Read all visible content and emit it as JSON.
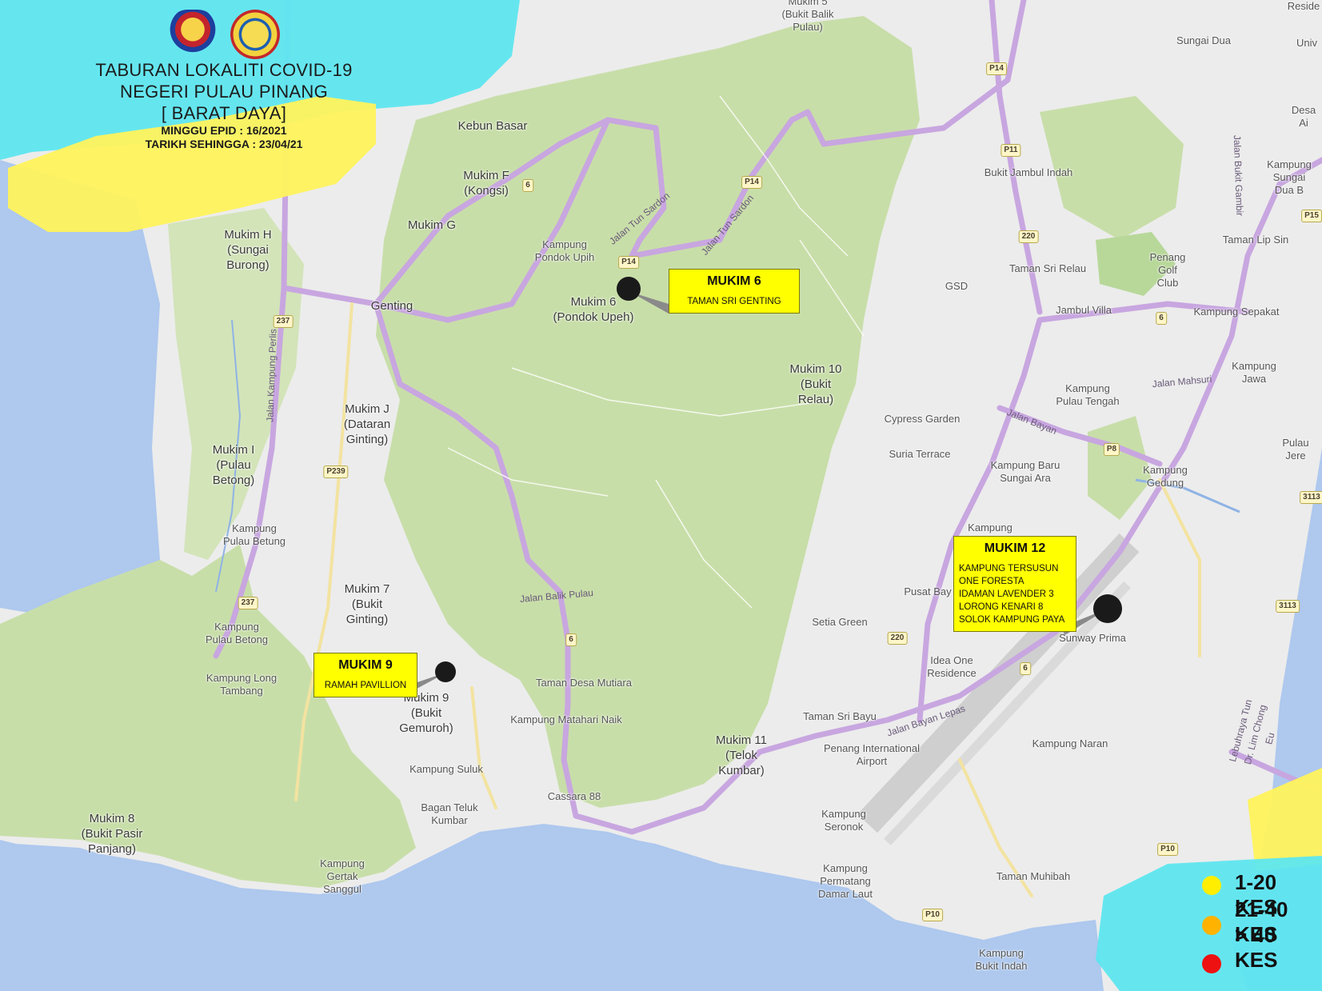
{
  "header": {
    "title_lines": [
      "TABURAN LOKALITI COVID-19",
      "NEGERI PULAU PINANG",
      "[ BARAT DAYA]"
    ],
    "week": "MINGGU EPID : 16/2021",
    "date": "TARIKH SEHINGGA : 23/04/21"
  },
  "place_labels": [
    "Mukim 5\n(Bukit Balik\nPulau)",
    "Sungai Dua",
    "Kebun Basar",
    "Mukim F\n(Kongsi)",
    "Mukim G",
    "Mukim H\n(Sungai\nBurong)",
    "Kampung\nPondok Upih",
    "Genting",
    "Mukim 6\n(Pondok Upeh)",
    "Mukim 10\n(Bukit\nRelau)",
    "Mukim J\n(Dataran\nGinting)",
    "Mukim I\n(Pulau\nBetong)",
    "Kampung\nPulau Betung",
    "Mukim 7\n(Bukit\nGinting)",
    "Kampung\nPulau Betong",
    "Kampung Long\nTambang",
    "Mukim 9\n(Bukit\nGemuroh)",
    "Taman Desa Mutiara",
    "Kampung Matahari Naik",
    "Kampung Suluk",
    "Cassara 88",
    "Bagan Teluk\nKumbar",
    "Mukim 8\n(Bukit Pasir\nPanjang)",
    "Kampung\nGertak\nSanggul",
    "Mukim 11\n(Telok\nKumbar)",
    "Taman Sri Bayu",
    "Penang International\nAirport",
    "Kampung\nSeronok",
    "Kampung\nPermatang\nDamar Laut",
    "Kampung\nBukit Indah",
    "Taman Muhibah",
    "Kampung Naran",
    "Idea One\nResidence",
    "Setia Green",
    "Pusat Bay",
    "Sunway Prima",
    "Kampung",
    "Kampung Baru\nSungai Ara",
    "Suria Terrace",
    "Cypress Garden",
    "Kampung\nPulau Tengah",
    "Kampung\nGedung",
    "Pulau Jere",
    "Kampung Jawa",
    "Kampung Sepakat",
    "Jambul Villa",
    "GSD",
    "Taman Sri Relau",
    "Taman Lip Sin",
    "Penang\nGolf\nClub",
    "Bukit Jambul Indah",
    "Kampung\nSungai Dua B",
    "Desa Ai",
    "Reside",
    "Univ"
  ],
  "road_labels": [
    "Jalan Tun Sardon",
    "Jalan Tun Sardon",
    "Jalan Balik Pulau",
    "Jalan Bayan",
    "Jalan Bayan Lepas",
    "Jalan Kampung Perlis",
    "Jalan Mahsuri",
    "Lebuhraya Tun Dr. Lim Chong Eu",
    "Jalan Bukit Gambir"
  ],
  "route_shields": [
    "P14",
    "P14",
    "P14",
    "P11",
    "220",
    "220",
    "6",
    "6",
    "6",
    "6",
    "237",
    "237",
    "P239",
    "P8",
    "P10",
    "P10",
    "P15",
    "3113",
    "3113"
  ],
  "callouts": [
    {
      "title": "MUKIM 6",
      "lines": [
        "TAMAN SRI GENTING"
      ]
    },
    {
      "title": "MUKIM 9",
      "lines": [
        "RAMAH PAVILLION"
      ]
    },
    {
      "title": "MUKIM 12",
      "lines": [
        "KAMPUNG TERSUSUN",
        "ONE FORESTA",
        "IDAMAN LAVENDER 3",
        "LORONG KENARI 8",
        "SOLOK KAMPUNG PAYA"
      ]
    }
  ],
  "legend": [
    {
      "label": "1-20 KES",
      "color": "#ffee00"
    },
    {
      "label": "21-40 KES",
      "color": "#ffb300"
    },
    {
      "label": "> 40 KES",
      "color": "#ee1111"
    }
  ]
}
